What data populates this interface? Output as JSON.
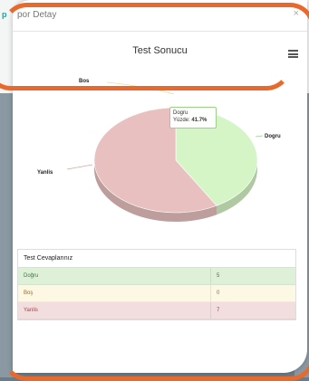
{
  "background": {
    "fragment_text": "p"
  },
  "modal": {
    "title": "por Detay",
    "close_icon": "×"
  },
  "chart_data": {
    "type": "pie",
    "title": "Test Sonucu",
    "slices": [
      {
        "name": "Dogru",
        "value": 5,
        "percent": 41.7,
        "color": "#d6f5c6"
      },
      {
        "name": "Bos",
        "value": 0,
        "percent": 0,
        "color": "#fff3c2"
      },
      {
        "name": "Yanlis",
        "value": 7,
        "percent": 58.3,
        "color": "#e8c0bf"
      }
    ],
    "labels": {
      "dogru": "Dogru",
      "bos": "Bos",
      "yanlis": "Yanlis"
    },
    "tooltip": {
      "name": "Dogru",
      "label": "Yüzde",
      "value": "41.7%"
    }
  },
  "results": {
    "heading": "Test Cevaplarınız",
    "rows": [
      {
        "label": "Doğru",
        "count": "5",
        "bg": "#dff0d8",
        "fg": "#3c763d"
      },
      {
        "label": "Boş",
        "count": "0",
        "bg": "#fcf8e3",
        "fg": "#8a6d3b"
      },
      {
        "label": "Yanlis",
        "count": "7",
        "bg": "#f2dede",
        "fg": "#a94442"
      }
    ]
  }
}
